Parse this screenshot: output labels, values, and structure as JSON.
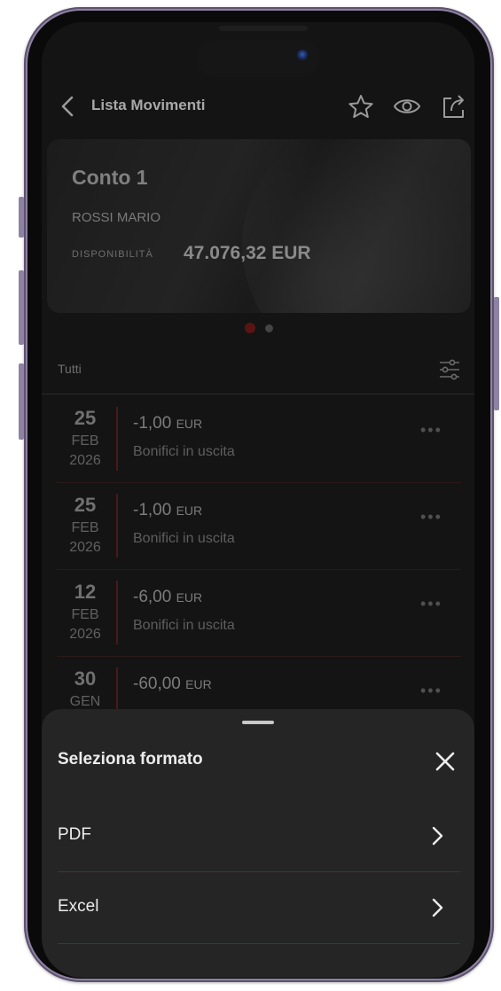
{
  "header": {
    "title": "Lista Movimenti"
  },
  "account_card": {
    "name": "Conto 1",
    "owner": "ROSSI MARIO",
    "availability_label": "DISPONIBILITÀ",
    "availability_value": "47.076,32 EUR"
  },
  "pager": {
    "count": 2,
    "active_index": 0
  },
  "filter": {
    "label": "Tutti"
  },
  "transactions": [
    {
      "day": "25",
      "month": "FEB",
      "year": "2026",
      "amount": "-1,00",
      "currency": "EUR",
      "description": "Bonifici in uscita"
    },
    {
      "day": "25",
      "month": "FEB",
      "year": "2026",
      "amount": "-1,00",
      "currency": "EUR",
      "description": "Bonifici in uscita"
    },
    {
      "day": "12",
      "month": "FEB",
      "year": "2026",
      "amount": "-6,00",
      "currency": "EUR",
      "description": "Bonifici in uscita"
    },
    {
      "day": "30",
      "month": "GEN",
      "year": "",
      "amount": "-60,00",
      "currency": "EUR",
      "description": ""
    }
  ],
  "bottom_sheet": {
    "title": "Seleziona formato",
    "options": [
      {
        "label": "PDF"
      },
      {
        "label": "Excel"
      }
    ]
  },
  "colors": {
    "accent_red": "#8a1d1d",
    "sheet_bg": "#252525",
    "text_light": "#ececec"
  },
  "icons": {
    "back": "chevron-left-icon",
    "favorite": "star-icon",
    "visibility": "eye-icon",
    "share": "share-icon",
    "filter": "sliders-icon",
    "more": "more-horizontal-icon",
    "close": "close-icon",
    "option_arrow": "chevron-right-icon"
  }
}
